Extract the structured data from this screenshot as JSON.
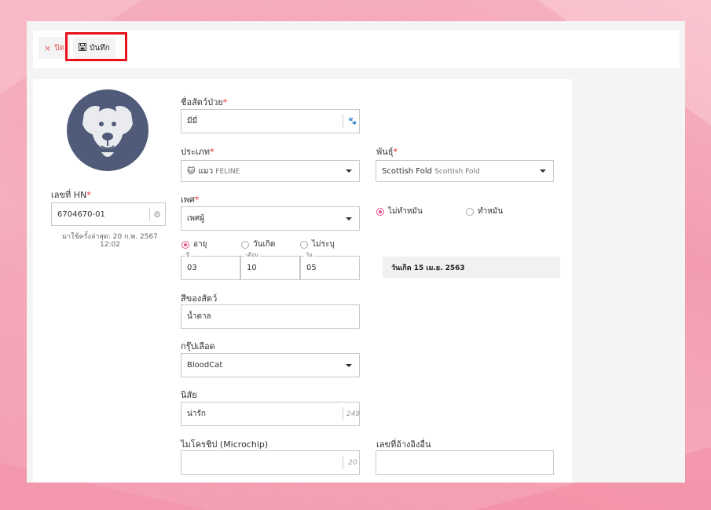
{
  "toolbar": {
    "close_label": "ปิด",
    "save_label": "บันทึก"
  },
  "icons": {
    "close": "close-icon",
    "save": "floppy-disk-icon",
    "paw": "paw-icon",
    "cat": "cat-face-icon",
    "avatar": "dog-avatar-icon"
  },
  "hn": {
    "label": "เลขที่ HN",
    "value": "6704670-01",
    "last_visit": "มาใช้ครั้งล่าสุด: 20 ก.พ. 2567 12:02"
  },
  "pet_name": {
    "label": "ชื่อสัตว์ป่วย",
    "value": "มีมี่"
  },
  "type": {
    "label": "ประเภท",
    "value": "แมว",
    "sub": "FELINE"
  },
  "breed": {
    "label": "พันธุ์",
    "value": "Scottish Fold",
    "sub": "Scottish Fold"
  },
  "sex": {
    "label": "เพศ",
    "value": "เพศผู้"
  },
  "neuter": {
    "options": [
      "ไม่ทำหมัน",
      "ทำหมัน"
    ],
    "selected": "ไม่ทำหมัน"
  },
  "age_mode": {
    "options": [
      "อายุ",
      "วันเกิด",
      "ไม่ระบุ"
    ],
    "selected": "อายุ"
  },
  "age": {
    "year_label": "ปี",
    "year": "03",
    "month_label": "เดือน",
    "month": "10",
    "day_label": "วัน",
    "day": "05"
  },
  "birth_display": "วันเกิด 15 เม.ย. 2563",
  "color": {
    "label": "สีของสัตว์",
    "value": "น้ำตาล"
  },
  "blood": {
    "label": "กรุ๊ปเลือด",
    "value": "BloodCat"
  },
  "habit": {
    "label": "นิสัย",
    "value": "น่ารัก",
    "counter": "249"
  },
  "microchip": {
    "label": "ไมโครชิป (Microchip)",
    "value": "",
    "counter": "20"
  },
  "other_ref": {
    "label": "เลขที่อ้างอิงอื่น",
    "value": ""
  },
  "colors": {
    "accent": "#e8518c",
    "required": "#e0262d",
    "avatar_bg": "#4f5b78",
    "highlight": "#e8111b"
  }
}
